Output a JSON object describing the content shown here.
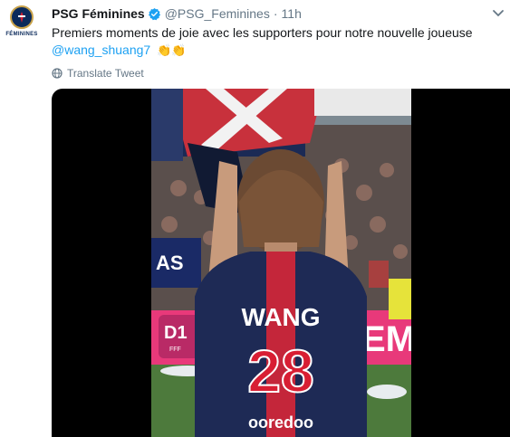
{
  "account": {
    "name": "PSG Féminines",
    "handle": "@PSG_Feminines",
    "separator": "·",
    "time": "11h",
    "avatar_label": "FÉMININES",
    "verified": true
  },
  "tweet": {
    "text": "Premiers moments de joie avec les supporters pour notre nouvelle joueuse",
    "mention": "@wang_shuang7",
    "emoji": "👏👏"
  },
  "translate": {
    "label": "Translate Tweet"
  },
  "video": {
    "banner_left": "AS",
    "banner_d1": "D1",
    "banner_d1_sub": "FFF",
    "banner_right": "EM",
    "jersey_name": "WANG",
    "jersey_number": "28",
    "jersey_sponsor": "ooredoo"
  },
  "icons": {
    "verified": "verified-badge-icon",
    "caret": "chevron-down-icon",
    "globe": "globe-icon",
    "avatar": "psg-crest-logo"
  },
  "colors": {
    "link": "#1da1f2",
    "muted": "#657786",
    "verified": "#1da1f2",
    "psg_navy": "#0b2a5b",
    "psg_red": "#d81e33"
  }
}
